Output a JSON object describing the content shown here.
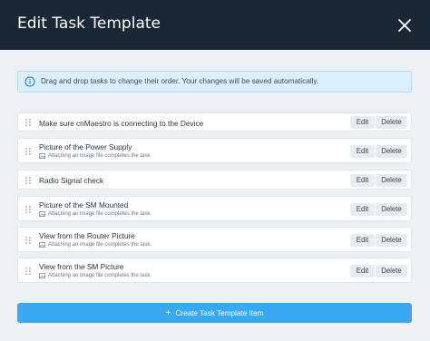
{
  "header": {
    "title": "Edit Task Template",
    "close_icon": "close-icon"
  },
  "info": {
    "text": "Drag and drop tasks to change their order. Your changes will be saved automatically.",
    "icon": "info-circle-icon"
  },
  "tasks": [
    {
      "label": "Make sure cnMaestro is connecting to the Device",
      "sub": "",
      "edit": "Edit",
      "delete": "Delete"
    },
    {
      "label": "Picture of the Power Supply",
      "sub": "Attaching an image file completes the task.",
      "edit": "Edit",
      "delete": "Delete"
    },
    {
      "label": "Radio Signal check",
      "sub": "",
      "edit": "Edit",
      "delete": "Delete"
    },
    {
      "label": "Picture of the SM Mounted",
      "sub": "Attaching an image file completes the task.",
      "edit": "Edit",
      "delete": "Delete"
    },
    {
      "label": "View from the Router Picture",
      "sub": "Attaching an image file completes the task.",
      "edit": "Edit",
      "delete": "Delete"
    },
    {
      "label": "View from the SM Picture",
      "sub": "Attaching an image file completes the task.",
      "edit": "Edit",
      "delete": "Delete"
    }
  ],
  "create_button": {
    "label": "Create Task Template Item",
    "icon": "plus-icon"
  },
  "colors": {
    "header_bg": "#1b2735",
    "accent": "#3aa7f1",
    "info_bg": "#dcefff"
  }
}
